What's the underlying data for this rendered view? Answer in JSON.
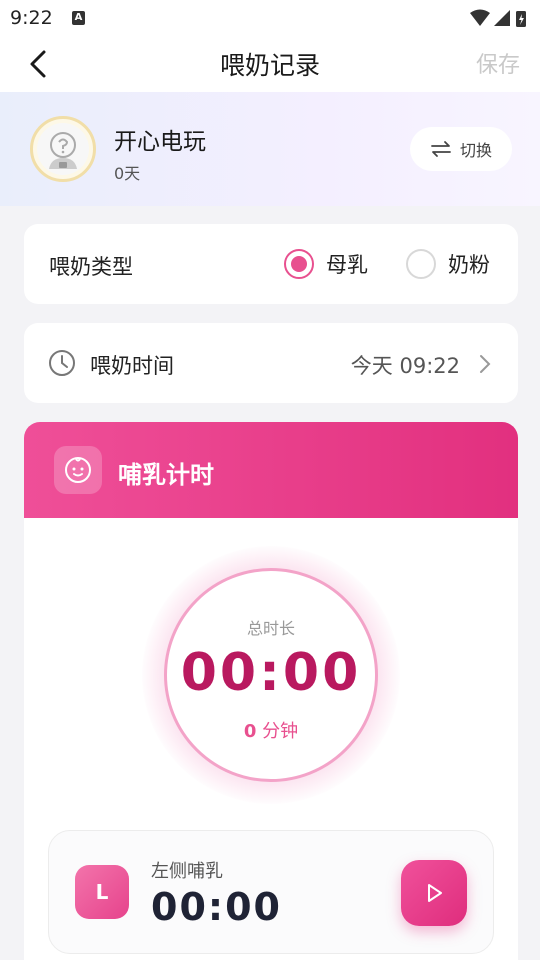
{
  "status": {
    "time": "9:22",
    "notif_letter": "A"
  },
  "header": {
    "title": "喂奶记录",
    "save_label": "保存"
  },
  "baby": {
    "name": "开心电玩",
    "age": "0天",
    "switch_label": "切换"
  },
  "feed_type": {
    "label": "喂奶类型",
    "options": [
      {
        "label": "母乳",
        "selected": true
      },
      {
        "label": "奶粉",
        "selected": false
      }
    ]
  },
  "feed_time": {
    "label": "喂奶时间",
    "value": "今天 09:22"
  },
  "timer": {
    "title": "哺乳计时",
    "total_label": "总时长",
    "total_time": "00:00",
    "total_minutes": "0",
    "minutes_unit": "分钟",
    "left": {
      "badge": "L",
      "label": "左侧哺乳",
      "time": "00:00"
    }
  },
  "colors": {
    "accent": "#e8508f",
    "accent_dark": "#b9195f"
  }
}
